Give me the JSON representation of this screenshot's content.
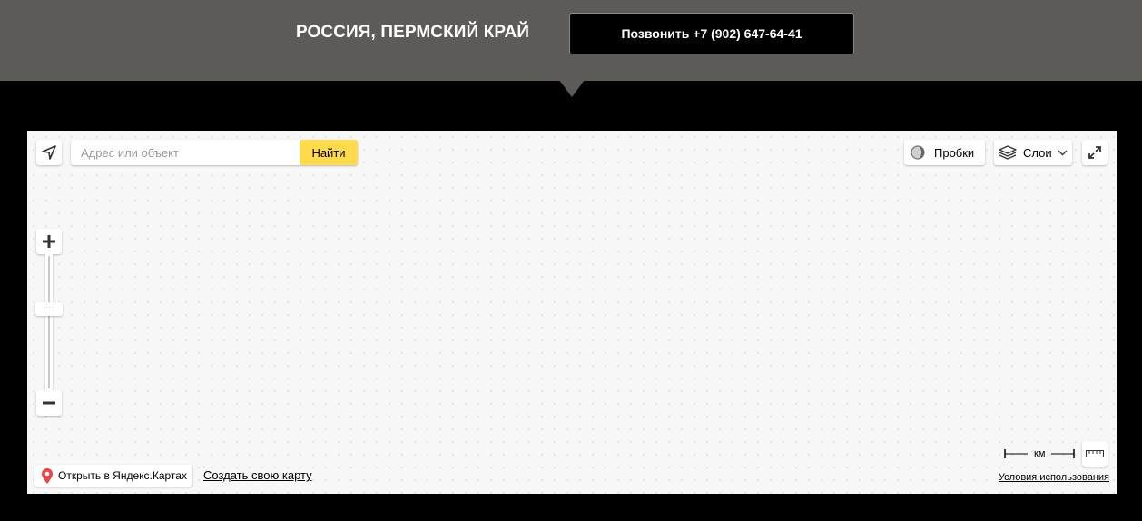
{
  "header": {
    "region": "РОССИЯ, ПЕРМСКИЙ КРАЙ",
    "call_label": "Позвонить +7 (902) 647-64-41"
  },
  "map": {
    "search": {
      "placeholder": "Адрес или объект",
      "button_label": "Найти"
    },
    "traffic_label": "Пробки",
    "layers_label": "Слои",
    "zoom_in_icon": "plus-icon",
    "zoom_out_icon": "minus-icon",
    "open_in_ymaps_label": "Открыть в Яндекс.Картах",
    "create_map_label": "Создать свою карту",
    "scale_unit": "км",
    "terms_label": "Условия использования",
    "accent_color": "#ffdb4d",
    "pin_color": "#ed4543"
  }
}
